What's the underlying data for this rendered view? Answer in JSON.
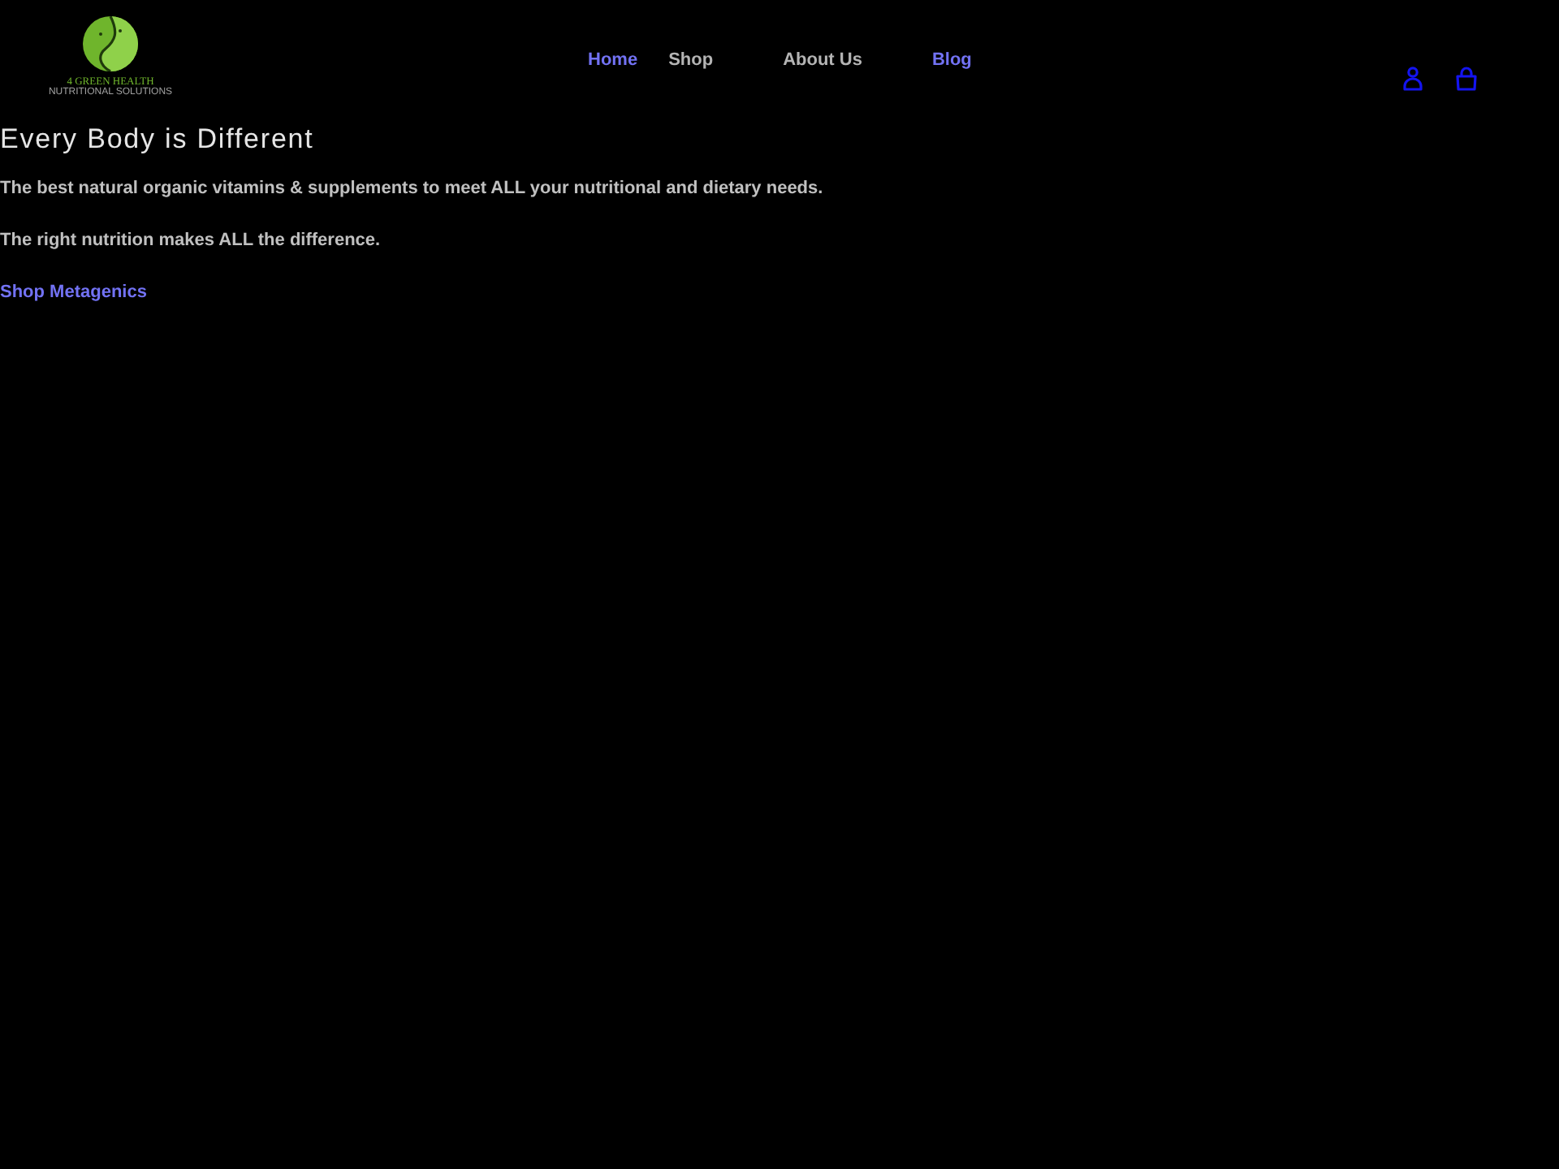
{
  "header": {
    "logo": {
      "name": "4 GREEN HEALTH",
      "tagline": "NUTRITIONAL SOLUTIONS"
    },
    "nav": [
      {
        "label": "Home",
        "kind": "link"
      },
      {
        "label": "Shop",
        "kind": "menu"
      },
      {
        "label": "About Us",
        "kind": "menu"
      },
      {
        "label": "Blog",
        "kind": "link"
      }
    ],
    "actions": [
      {
        "kind": "account"
      },
      {
        "kind": "cart"
      }
    ]
  },
  "hero": {
    "heading": "Every Body is Different",
    "paragraphs": [
      "The best natural organic vitamins & supplements to meet ALL your nutritional and dietary needs.",
      "The right nutrition makes ALL the difference."
    ],
    "link": "Shop Metagenics"
  }
}
